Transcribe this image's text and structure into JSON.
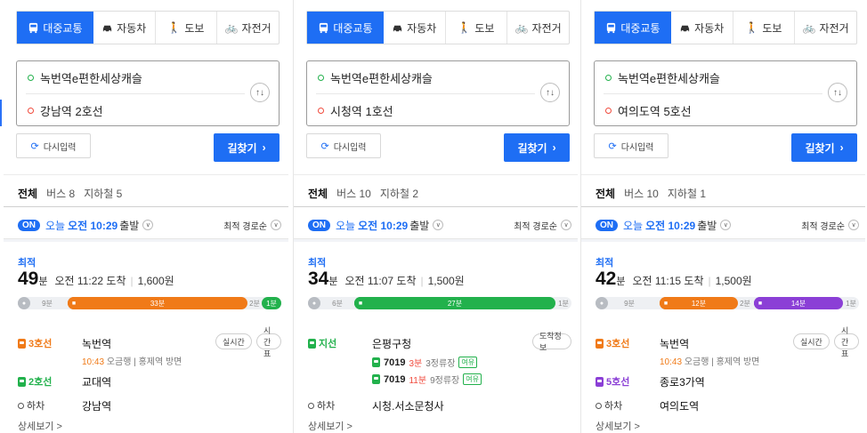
{
  "modes": {
    "transit": "대중교통",
    "car": "자동차",
    "walk": "도보",
    "bike": "자전거"
  },
  "colors": {
    "accent": "#1e6ef4",
    "line3": "#f07a18",
    "line2": "#22b14c",
    "line1": "#1e4fa8",
    "line5": "#8b3fd6",
    "green_bus": "#22b14c",
    "red": "#f04a3c"
  },
  "labels": {
    "reset": "다시입력",
    "find": "길찾기",
    "tab_all": "전체",
    "today": "오늘",
    "depart_suffix": "출발",
    "sort": "최적 경로순",
    "on": "ON",
    "best": "최적",
    "minute_unit": "분",
    "arrive_prefix": "오전",
    "arrive_suffix": "도착",
    "more": "상세보기 >"
  },
  "panels": [
    {
      "origin": "녹번역e편한세상캐슬",
      "destination": "강남역 2호선",
      "tabs": {
        "bus": "버스 8",
        "subway": "지하철 5"
      },
      "depart_time": "오전 10:29",
      "summary": {
        "minutes": "49",
        "arrive": "11:22",
        "fare": "1,600원"
      },
      "timeline": [
        {
          "type": "walk",
          "label": "9분"
        },
        {
          "type": "line3",
          "label": "33분"
        },
        {
          "type": "walk",
          "label": "2분"
        },
        {
          "type": "line2",
          "label": "1분"
        }
      ],
      "legs": [
        {
          "line": "3호선",
          "station": "녹번역",
          "time": "10:43",
          "detail": "오금행 | 홍제역 방면",
          "chip1": "실시간",
          "chip2": "시간표"
        },
        {
          "line": "2호선",
          "station": "교대역"
        }
      ],
      "getoff": {
        "label": "하차",
        "station": "강남역"
      }
    },
    {
      "origin": "녹번역e편한세상캐슬",
      "destination": "시청역 1호선",
      "tabs": {
        "bus": "버스 10",
        "subway": "지하철 2"
      },
      "depart_time": "오전 10:29",
      "summary": {
        "minutes": "34",
        "arrive": "11:07",
        "fare": "1,500원"
      },
      "timeline": [
        {
          "type": "walk",
          "label": "6분"
        },
        {
          "type": "bus",
          "label": "27분"
        },
        {
          "type": "walk",
          "label": "1분"
        }
      ],
      "legs": [
        {
          "line": "지선",
          "station": "은평구청",
          "chip1": "도착정보"
        }
      ],
      "buses": [
        {
          "num": "7019",
          "eta": "3분",
          "stops": "3정류장",
          "tag": "여유"
        },
        {
          "num": "7019",
          "eta": "11분",
          "stops": "9정류장",
          "tag": "여유"
        }
      ],
      "getoff": {
        "label": "하차",
        "station": "시청.서소문청사"
      }
    },
    {
      "origin": "녹번역e편한세상캐슬",
      "destination": "여의도역 5호선",
      "tabs": {
        "bus": "버스 10",
        "subway": "지하철 1"
      },
      "depart_time": "오전 10:29",
      "summary": {
        "minutes": "42",
        "arrive": "11:15",
        "fare": "1,500원"
      },
      "timeline": [
        {
          "type": "walk",
          "label": "9분"
        },
        {
          "type": "line3",
          "label": "12분"
        },
        {
          "type": "walk",
          "label": "2분"
        },
        {
          "type": "line5",
          "label": "14분"
        },
        {
          "type": "walk",
          "label": "1분"
        }
      ],
      "legs": [
        {
          "line": "3호선",
          "station": "녹번역",
          "time": "10:43",
          "detail": "오금행 | 홍제역 방면",
          "chip1": "실시간",
          "chip2": "시간표"
        },
        {
          "line": "5호선",
          "station": "종로3가역"
        }
      ],
      "getoff": {
        "label": "하차",
        "station": "여의도역"
      }
    }
  ]
}
